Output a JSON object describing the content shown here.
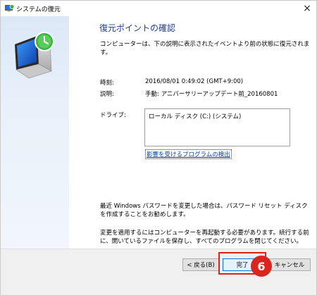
{
  "window": {
    "title": "システムの復元",
    "close_icon": "×"
  },
  "page": {
    "heading": "復元ポイントの確認",
    "subtext": "コンピューターは、下の説明に表示されたイベントより前の状態に復元されます。",
    "time_label": "時刻:",
    "time_value": "2016/08/01 0:49:02 (GMT+9:00)",
    "desc_label": "説明:",
    "desc_value": "手動: アニバーサリーアップデート前_20160801",
    "drive_label": "ドライブ:",
    "drive_value": "ローカル ディスク (C:) (システム)",
    "link_label": "影響を受けるプログラムの検出",
    "password_note": "最近 Windows パスワードを変更した場合は、パスワード リセット ディスクを作成することをお勧めします。",
    "restart_note": "変更を適用するにはコンピューターを再起動する必要があります。続行する前に、開いているファイルを保存し、すべてのプログラムを閉じてください。"
  },
  "footer": {
    "back_label": "< 戻る(B)",
    "finish_label": "完了",
    "cancel_label": "キャンセル"
  },
  "annotation": {
    "step_number": "6",
    "color": "#d8261c"
  }
}
